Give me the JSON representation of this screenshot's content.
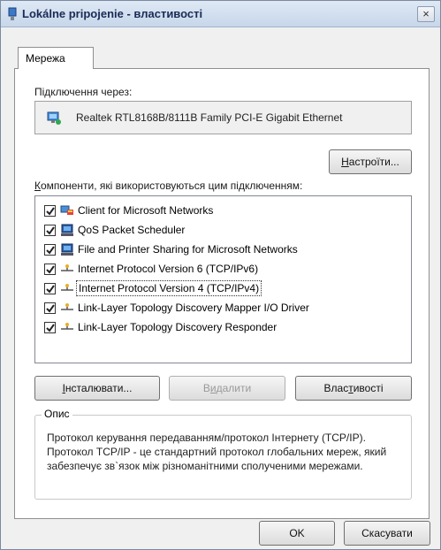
{
  "window": {
    "title": "Lokálne pripojenie - властивості",
    "close_label": "×"
  },
  "tab": {
    "label": "Мережа"
  },
  "connect_using": {
    "label": "Підключення через:",
    "adapter": "Realtek RTL8168B/8111B Family PCI-E Gigabit Ethernet"
  },
  "configure_button": {
    "label_pre": "",
    "label_ul": "Н",
    "label_post": "астроїти..."
  },
  "components": {
    "label_ul": "К",
    "label_post": "омпоненти, які використовуються цим підключенням:",
    "items": [
      {
        "label": "Client for Microsoft Networks",
        "checked": true,
        "icon": "network-client-icon"
      },
      {
        "label": "QoS Packet Scheduler",
        "checked": true,
        "icon": "computer-service-icon"
      },
      {
        "label": "File and Printer Sharing for Microsoft Networks",
        "checked": true,
        "icon": "computer-service-icon"
      },
      {
        "label": "Internet Protocol Version 6 (TCP/IPv6)",
        "checked": true,
        "icon": "protocol-icon"
      },
      {
        "label": "Internet Protocol Version 4 (TCP/IPv4)",
        "checked": true,
        "icon": "protocol-icon",
        "selected": true
      },
      {
        "label": "Link-Layer Topology Discovery Mapper I/O Driver",
        "checked": true,
        "icon": "protocol-icon"
      },
      {
        "label": "Link-Layer Topology Discovery Responder",
        "checked": true,
        "icon": "protocol-icon"
      }
    ]
  },
  "buttons": {
    "install": {
      "ul": "І",
      "post": "нсталювати..."
    },
    "remove": {
      "pre": "В",
      "ul": "и",
      "post": "далити"
    },
    "properties": {
      "pre": "Влас",
      "ul": "т",
      "post": "ивості"
    }
  },
  "description": {
    "title": "Опис",
    "text": "Протокол керування передаванням/протокол Інтернету (TCP/IP). Протокол TCP/IP - це стандартний протокол глобальних мереж, який забезпечує зв`язок між різноманітними сполученими мережами."
  },
  "footer": {
    "ok": "OK",
    "cancel": "Скасувати"
  }
}
